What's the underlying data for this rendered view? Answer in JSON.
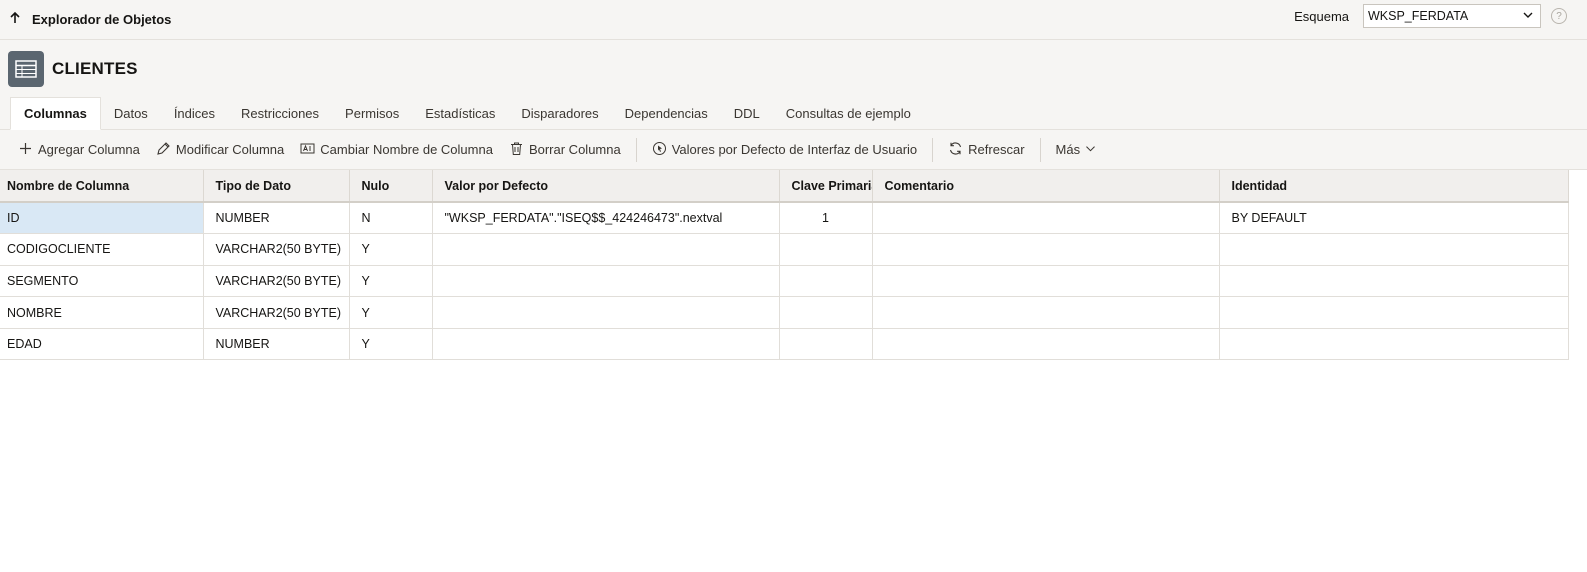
{
  "topbar": {
    "back_label": "Explorador de Objetos",
    "schema_label": "Esquema",
    "schema_value": "WKSP_FERDATA",
    "help_glyph": "?"
  },
  "header": {
    "title": "CLIENTES",
    "icon": "table-icon"
  },
  "tabs": [
    {
      "label": "Columnas",
      "active": true
    },
    {
      "label": "Datos"
    },
    {
      "label": "Índices"
    },
    {
      "label": "Restricciones"
    },
    {
      "label": "Permisos"
    },
    {
      "label": "Estadísticas"
    },
    {
      "label": "Disparadores"
    },
    {
      "label": "Dependencias"
    },
    {
      "label": "DDL"
    },
    {
      "label": "Consultas de ejemplo"
    }
  ],
  "toolbar": {
    "add_column": "Agregar Columna",
    "modify_column": "Modificar Columna",
    "rename_column": "Cambiar Nombre de Columna",
    "delete_column": "Borrar Columna",
    "ui_defaults": "Valores por Defecto de Interfaz de Usuario",
    "refresh": "Refrescar",
    "more": "Más"
  },
  "grid": {
    "headers": [
      "Nombre de Columna",
      "Tipo de Dato",
      "Nulo",
      "Valor por Defecto",
      "Clave Primaria",
      "Comentario",
      "Identidad"
    ],
    "rows": [
      [
        "ID",
        "NUMBER",
        "N",
        "\"WKSP_FERDATA\".\"ISEQ$$_424246473\".nextval",
        "1",
        "",
        "BY DEFAULT"
      ],
      [
        "CODIGOCLIENTE",
        "VARCHAR2(50 BYTE)",
        "Y",
        "",
        "",
        "",
        ""
      ],
      [
        "SEGMENTO",
        "VARCHAR2(50 BYTE)",
        "Y",
        "",
        "",
        "",
        ""
      ],
      [
        "NOMBRE",
        "VARCHAR2(50 BYTE)",
        "Y",
        "",
        "",
        "",
        ""
      ],
      [
        "EDAD",
        "NUMBER",
        "Y",
        "",
        "",
        "",
        ""
      ]
    ]
  },
  "colors": {
    "selected_cell": "#d9e8f5",
    "icon_bg": "#5b6670"
  }
}
